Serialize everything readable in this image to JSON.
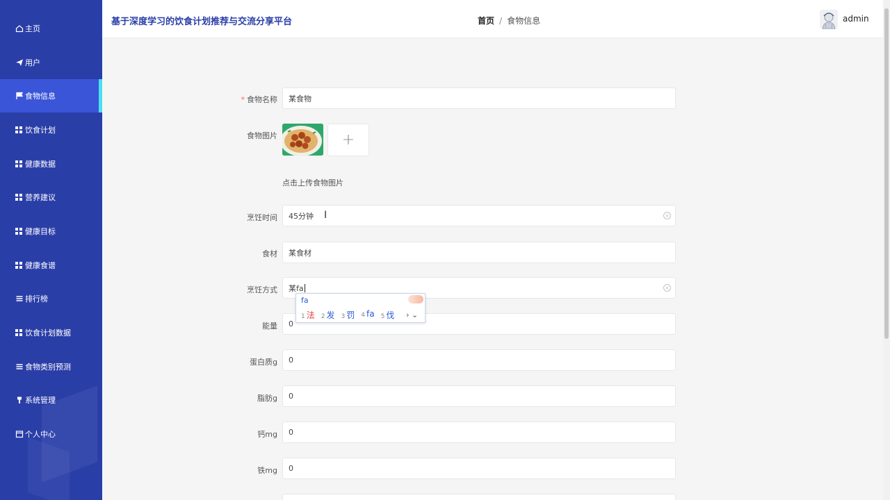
{
  "app": {
    "title": "基于深度学习的饮食计划推荐与交流分享平台"
  },
  "breadcrumb": {
    "home": "首页",
    "separator": "/",
    "current": "食物信息"
  },
  "user": {
    "name": "admin"
  },
  "sidebar": {
    "items": [
      {
        "label": "主页",
        "icon": "home-icon"
      },
      {
        "label": "用户",
        "icon": "send-icon"
      },
      {
        "label": "食物信息",
        "icon": "flag-icon",
        "active": true
      },
      {
        "label": "饮食计划",
        "icon": "grid-icon"
      },
      {
        "label": "健康数据",
        "icon": "grid-icon"
      },
      {
        "label": "营养建议",
        "icon": "grid-icon"
      },
      {
        "label": "健康目标",
        "icon": "grid-icon"
      },
      {
        "label": "健康食谱",
        "icon": "grid-icon"
      },
      {
        "label": "排行榜",
        "icon": "list-icon"
      },
      {
        "label": "饮食计划数据",
        "icon": "grid-icon"
      },
      {
        "label": "食物类别预测",
        "icon": "list-icon"
      },
      {
        "label": "系统管理",
        "icon": "pin-icon"
      },
      {
        "label": "个人中心",
        "icon": "calendar-icon"
      }
    ]
  },
  "form": {
    "food_name": {
      "label": "食物名称",
      "required_mark": "*",
      "value": "某食物"
    },
    "food_image": {
      "label": "食物图片",
      "upload_icon": "+",
      "hint": "点击上传食物图片"
    },
    "cook_time": {
      "label": "烹饪时间",
      "value": "45分钟"
    },
    "ingredients": {
      "label": "食材",
      "value": "某食材"
    },
    "cook_method": {
      "label": "烹饪方式",
      "value": "某fa"
    },
    "energy": {
      "label": "能量",
      "value": "0"
    },
    "protein": {
      "label": "蛋白质g",
      "value": "0"
    },
    "fat": {
      "label": "脂肪g",
      "value": "0"
    },
    "calcium": {
      "label": "钙mg",
      "value": "0"
    },
    "iron": {
      "label": "铁mg",
      "value": "0"
    }
  },
  "ime": {
    "input": "fa",
    "candidates": [
      {
        "num": "1",
        "text": "法"
      },
      {
        "num": "2",
        "text": "发"
      },
      {
        "num": "3",
        "text": "罚"
      },
      {
        "num": "4",
        "text": "fa"
      },
      {
        "num": "5",
        "text": "伐"
      }
    ],
    "nav": "› ⌄"
  },
  "colors": {
    "sidebar": "#2a3ea8",
    "active": "#3a55d8",
    "active_bar": "#49e0f0",
    "title": "#2a3ea8"
  }
}
